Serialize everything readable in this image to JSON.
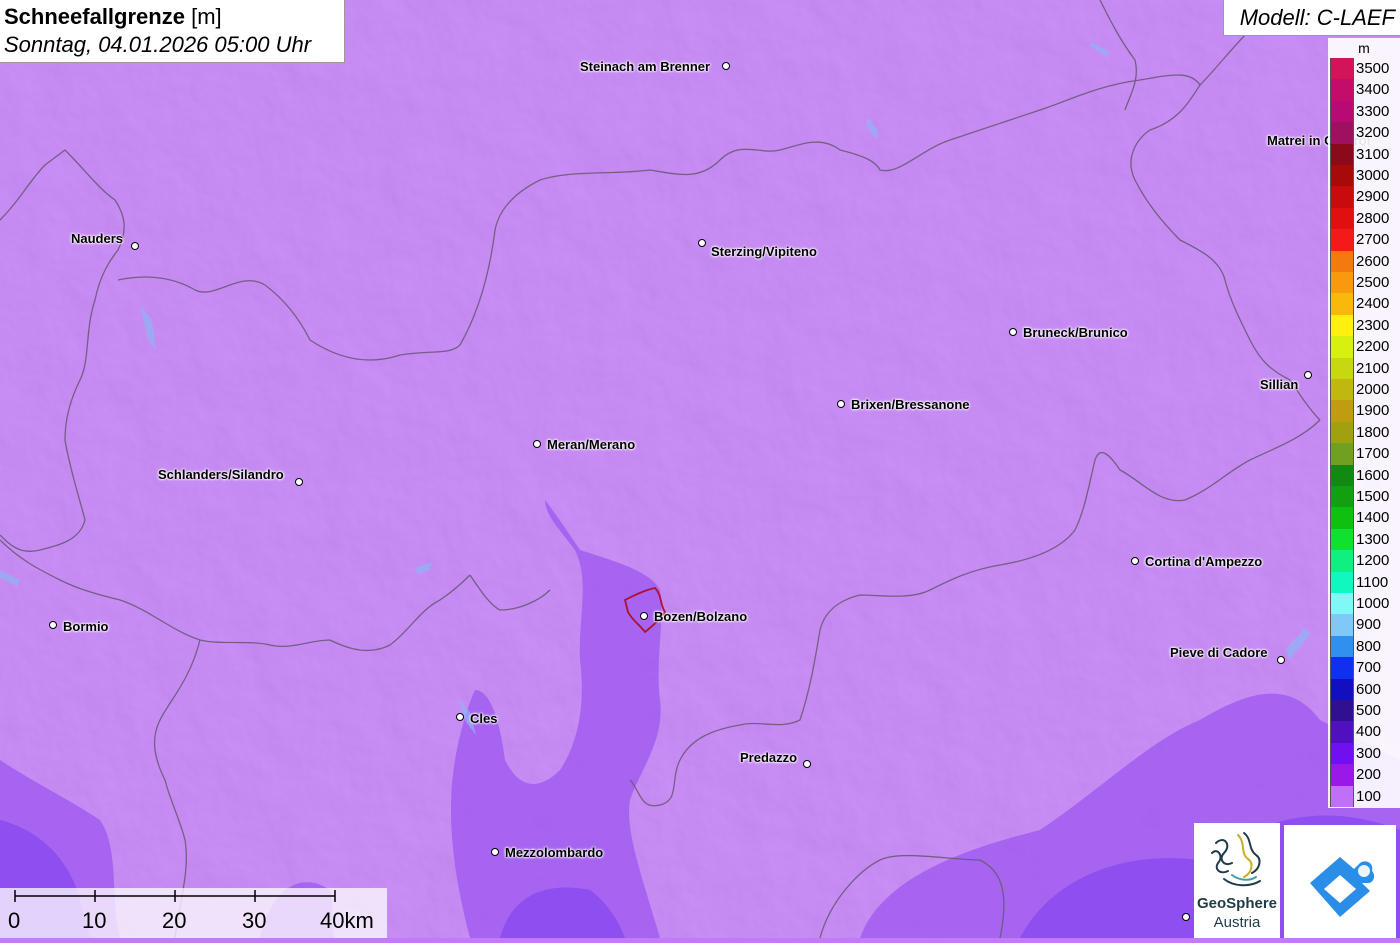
{
  "title": {
    "variable": "Schneefallgrenze",
    "unit": "[m]",
    "datetime": "Sonntag, 04.01.2026 05:00 Uhr"
  },
  "model": "Modell: C-LAEF",
  "legend": {
    "unit": "m",
    "entries": [
      {
        "label": "3500",
        "color": "#d4145a"
      },
      {
        "label": "3400",
        "color": "#c40c6a"
      },
      {
        "label": "3300",
        "color": "#b80a74"
      },
      {
        "label": "3200",
        "color": "#a01060"
      },
      {
        "label": "3100",
        "color": "#8b0a1a"
      },
      {
        "label": "3000",
        "color": "#a80a0a"
      },
      {
        "label": "2900",
        "color": "#c80c0c"
      },
      {
        "label": "2800",
        "color": "#e01010"
      },
      {
        "label": "2700",
        "color": "#f41a1a"
      },
      {
        "label": "2600",
        "color": "#f47a10"
      },
      {
        "label": "2500",
        "color": "#f89a10"
      },
      {
        "label": "2400",
        "color": "#f8b80c"
      },
      {
        "label": "2300",
        "color": "#fff010"
      },
      {
        "label": "2200",
        "color": "#d8f010"
      },
      {
        "label": "2100",
        "color": "#c8d810"
      },
      {
        "label": "2000",
        "color": "#c0b810"
      },
      {
        "label": "1900",
        "color": "#c09c10"
      },
      {
        "label": "1800",
        "color": "#a0a010"
      },
      {
        "label": "1700",
        "color": "#70a020"
      },
      {
        "label": "1600",
        "color": "#108a10"
      },
      {
        "label": "1500",
        "color": "#10a010"
      },
      {
        "label": "1400",
        "color": "#10c010"
      },
      {
        "label": "1300",
        "color": "#10e030"
      },
      {
        "label": "1200",
        "color": "#10f080"
      },
      {
        "label": "1100",
        "color": "#10f8c0"
      },
      {
        "label": "1000",
        "color": "#80f8f8"
      },
      {
        "label": "900",
        "color": "#80c8f8"
      },
      {
        "label": "800",
        "color": "#3090f0"
      },
      {
        "label": "700",
        "color": "#1030f0"
      },
      {
        "label": "600",
        "color": "#1010c0"
      },
      {
        "label": "500",
        "color": "#301090"
      },
      {
        "label": "400",
        "color": "#5010c0"
      },
      {
        "label": "300",
        "color": "#7010f0"
      },
      {
        "label": "200",
        "color": "#9a18e8"
      },
      {
        "label": "100",
        "color": "#c070f8"
      }
    ]
  },
  "places": [
    {
      "name": "Steinach am Brenner"
    },
    {
      "name": "Nauders"
    },
    {
      "name": "Sterzing/Vipiteno"
    },
    {
      "name": "Matrei in Osttirol"
    },
    {
      "name": "Bruneck/Brunico"
    },
    {
      "name": "Sillian"
    },
    {
      "name": "Brixen/Bressanone"
    },
    {
      "name": "Meran/Merano"
    },
    {
      "name": "Schlanders/Silandro"
    },
    {
      "name": "Cortina d'Ampezzo"
    },
    {
      "name": "Bormio"
    },
    {
      "name": "Bozen/Bolzano"
    },
    {
      "name": "Pieve di Cadore"
    },
    {
      "name": "Cles"
    },
    {
      "name": "Predazzo"
    },
    {
      "name": "Mezzolombardo"
    }
  ],
  "scale_bar": {
    "labels": [
      "0",
      "10",
      "20",
      "30",
      "40km"
    ]
  },
  "logos": {
    "geosphere_name": "GeoSphere",
    "geosphere_sub": "Austria"
  },
  "colors": {
    "base_snowline_100": "#c27af8",
    "snowline_200": "#9a3ae8",
    "snowline_300": "#7a2af0",
    "border": "#6a5a7a",
    "bolzano_outline": "#b01030"
  }
}
